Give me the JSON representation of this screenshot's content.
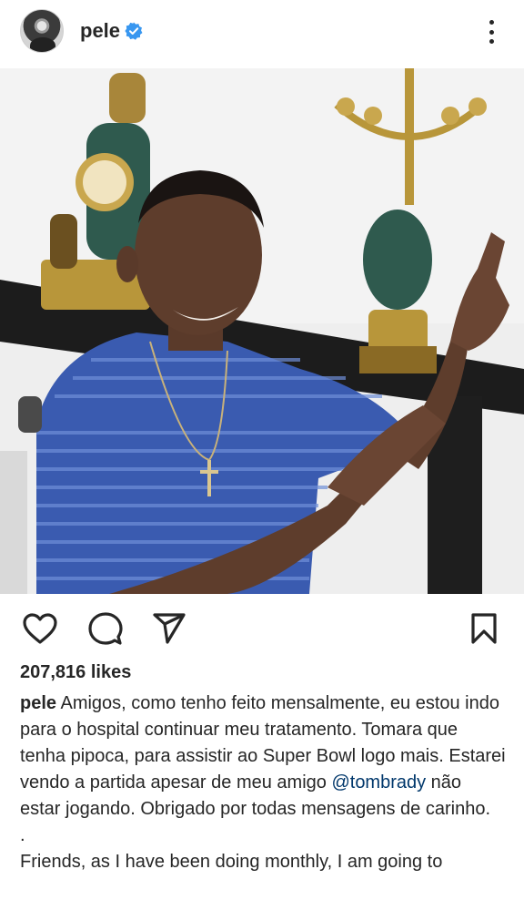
{
  "header": {
    "username": "pele",
    "avatar_icon": "profile-photo",
    "verified_icon": "verified-badge-icon",
    "verified_color": "#3897f0",
    "more_icon": "more-options-icon"
  },
  "post": {
    "image_icon": "post-photo"
  },
  "actions": {
    "like_icon": "heart-icon",
    "comment_icon": "comment-icon",
    "share_icon": "send-icon",
    "save_icon": "bookmark-icon"
  },
  "likes_text": "207,816 likes",
  "caption": {
    "username": "pele",
    "text_before_mention": " Amigos, como tenho feito mensalmente, eu estou indo para o hospital continuar meu tratamento. Tomara que tenha pipoca, para assistir ao Super Bowl logo mais. Estarei vendo a partida apesar de meu amigo ",
    "mention": "@tombrady",
    "text_after_mention": " não estar jogando. Obrigado por todas mensagens de carinho.",
    "separator": ".",
    "english_text": "Friends, as I have been doing monthly, I am going to",
    "mention_color": "#00376b"
  }
}
